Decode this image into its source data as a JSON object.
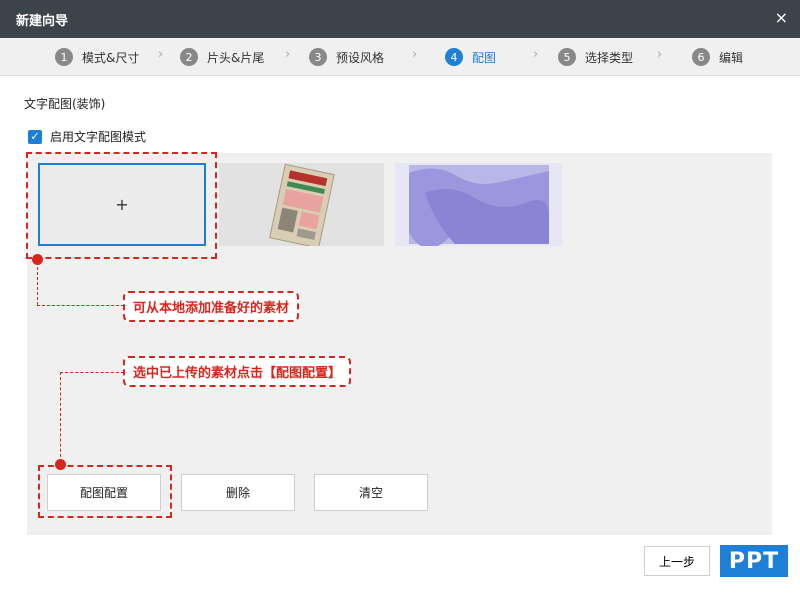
{
  "window": {
    "title": "新建向导",
    "close_icon": "×"
  },
  "steps": [
    {
      "num": "1",
      "label": "模式&尺寸"
    },
    {
      "num": "2",
      "label": "片头&片尾"
    },
    {
      "num": "3",
      "label": "预设风格"
    },
    {
      "num": "4",
      "label": "配图"
    },
    {
      "num": "5",
      "label": "选择类型"
    },
    {
      "num": "6",
      "label": "编辑"
    }
  ],
  "step_separator": "›",
  "section": {
    "title": "文字配图(装饰)",
    "checkbox_label": "启用文字配图模式",
    "checkbox_checked": true,
    "check_mark": "✓"
  },
  "tiles": {
    "add_symbol": "+"
  },
  "callouts": {
    "add_hint": "可从本地添加准备好的素材",
    "config_hint": "选中已上传的素材点击【配图配置】"
  },
  "buttons": {
    "config": "配图配置",
    "delete": "删除",
    "clear": "清空"
  },
  "footer": {
    "prev": "上一步",
    "logo": "PPT"
  },
  "colors": {
    "accent": "#1e7fd6",
    "annotation": "#d9261c",
    "titlebar": "#3d434a"
  }
}
